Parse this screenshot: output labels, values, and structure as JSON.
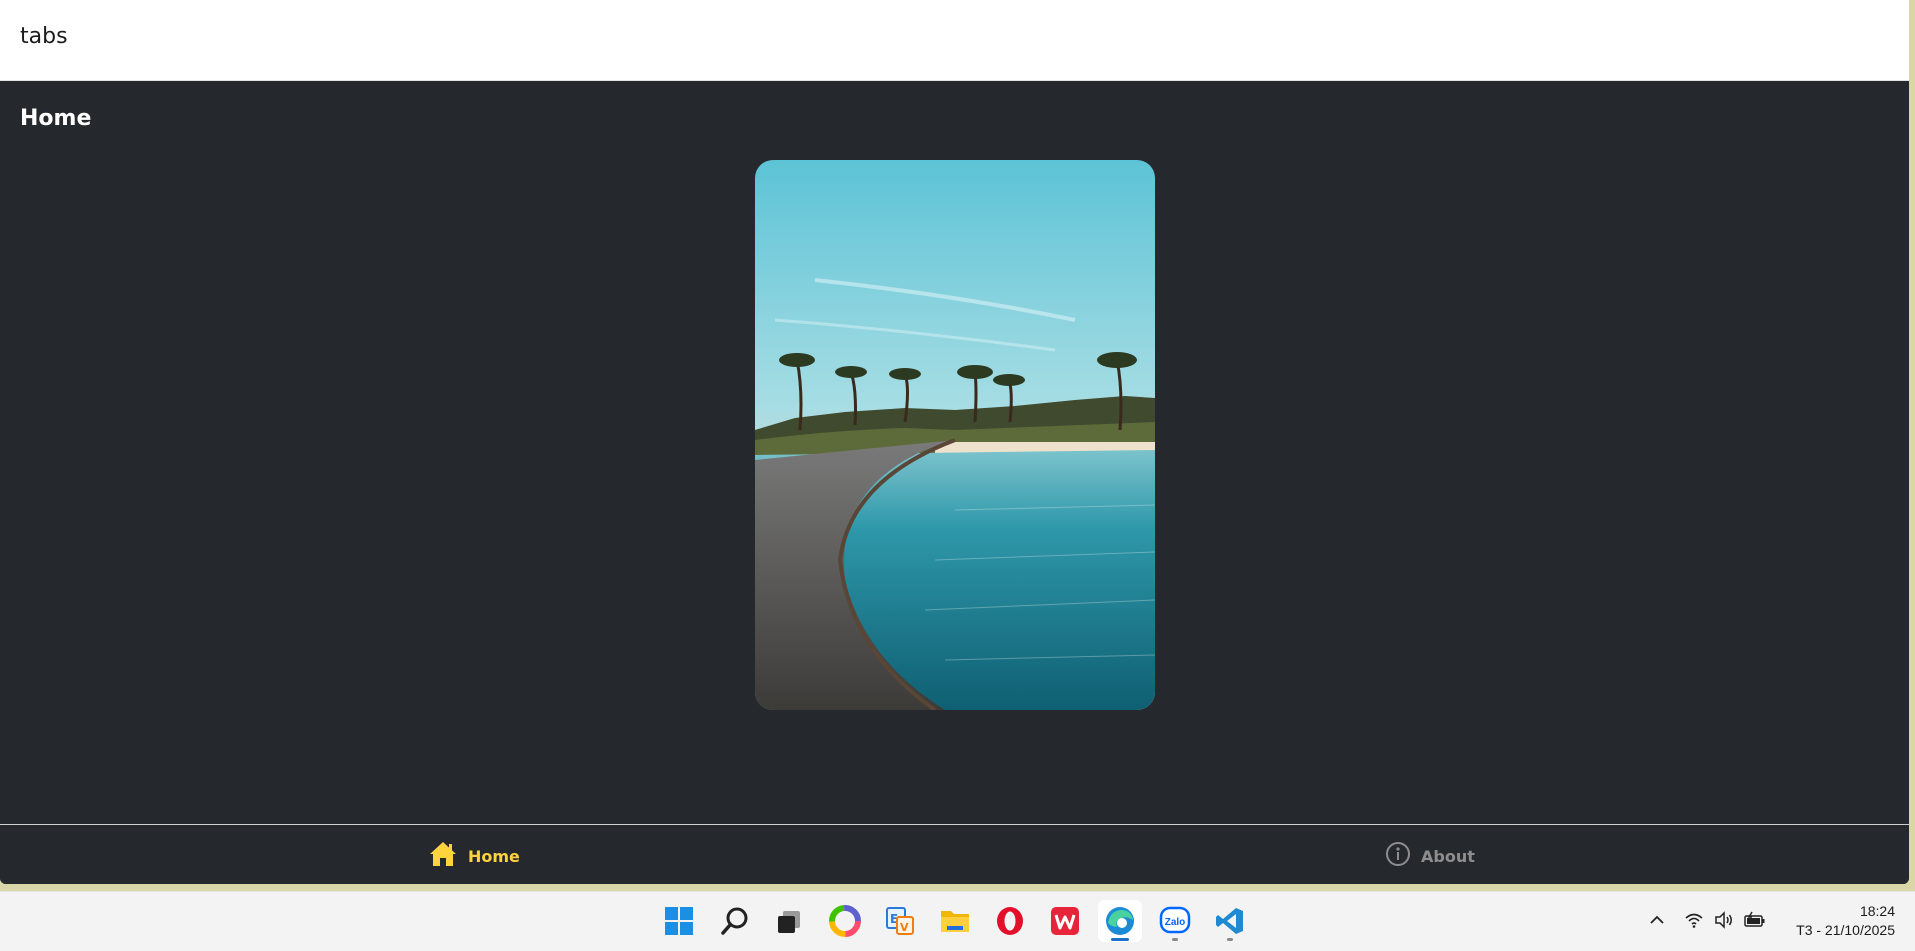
{
  "app": {
    "header_title": "tabs",
    "screen_title": "Home"
  },
  "tabs": [
    {
      "label": "Home",
      "icon": "home-icon",
      "active": true,
      "color": "#ffd33d"
    },
    {
      "label": "About",
      "icon": "info-icon",
      "active": false,
      "color": "#8e8e8e"
    }
  ],
  "taskbar": {
    "apps": [
      {
        "name": "start",
        "icon": "windows-start-icon"
      },
      {
        "name": "search",
        "icon": "search-icon"
      },
      {
        "name": "task-view",
        "icon": "task-view-icon"
      },
      {
        "name": "colorful-app",
        "icon": "color-wheel-icon"
      },
      {
        "name": "dictionary",
        "icon": "dictionary-icon"
      },
      {
        "name": "file-explorer",
        "icon": "folder-icon"
      },
      {
        "name": "opera",
        "icon": "opera-icon"
      },
      {
        "name": "wps-office",
        "icon": "wps-icon"
      },
      {
        "name": "edge",
        "icon": "edge-icon",
        "active": true
      },
      {
        "name": "zalo",
        "icon": "zalo-icon",
        "label": "Zalo"
      },
      {
        "name": "vscode",
        "icon": "vscode-icon"
      }
    ],
    "clock": {
      "time": "18:24",
      "date": "T3 - 21/10/2025"
    }
  },
  "colors": {
    "background": "#25292e",
    "accent": "#ffd33d",
    "inactive": "#8e8e8e"
  }
}
